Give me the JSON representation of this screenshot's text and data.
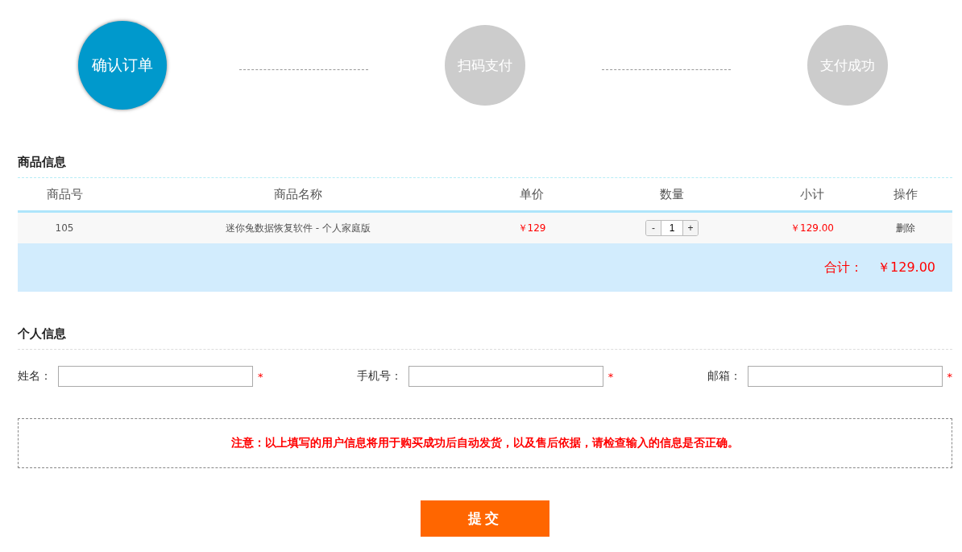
{
  "steps": [
    {
      "label": "确认订单",
      "selected": true
    },
    {
      "label": "扫码支付",
      "selected": false
    },
    {
      "label": "支付成功",
      "selected": false
    }
  ],
  "product_section": {
    "title": "商品信息"
  },
  "table": {
    "columns": [
      "商品号",
      "商品名称",
      "单价",
      "数量",
      "小计",
      "操作"
    ],
    "rows": [
      {
        "id": "105",
        "name": "迷你兔数据恢复软件 - 个人家庭版",
        "price": "￥129",
        "minus": "-",
        "quantity": "1",
        "plus": "+",
        "subtotal": "￥129.00",
        "action": "删除"
      }
    ],
    "total_label": "合计：",
    "total_value": "￥129.00"
  },
  "personal_section": {
    "title": "个人信息"
  },
  "fields": [
    {
      "label": "姓名：",
      "required_mark": "*"
    },
    {
      "label": "手机号：",
      "required_mark": "*"
    },
    {
      "label": "邮箱：",
      "required_mark": "*"
    }
  ],
  "notice": "注意：以上填写的用户信息将用于购买成功后自动发货，以及售后依据，请检查输入的信息是否正确。",
  "submit": "提交"
}
